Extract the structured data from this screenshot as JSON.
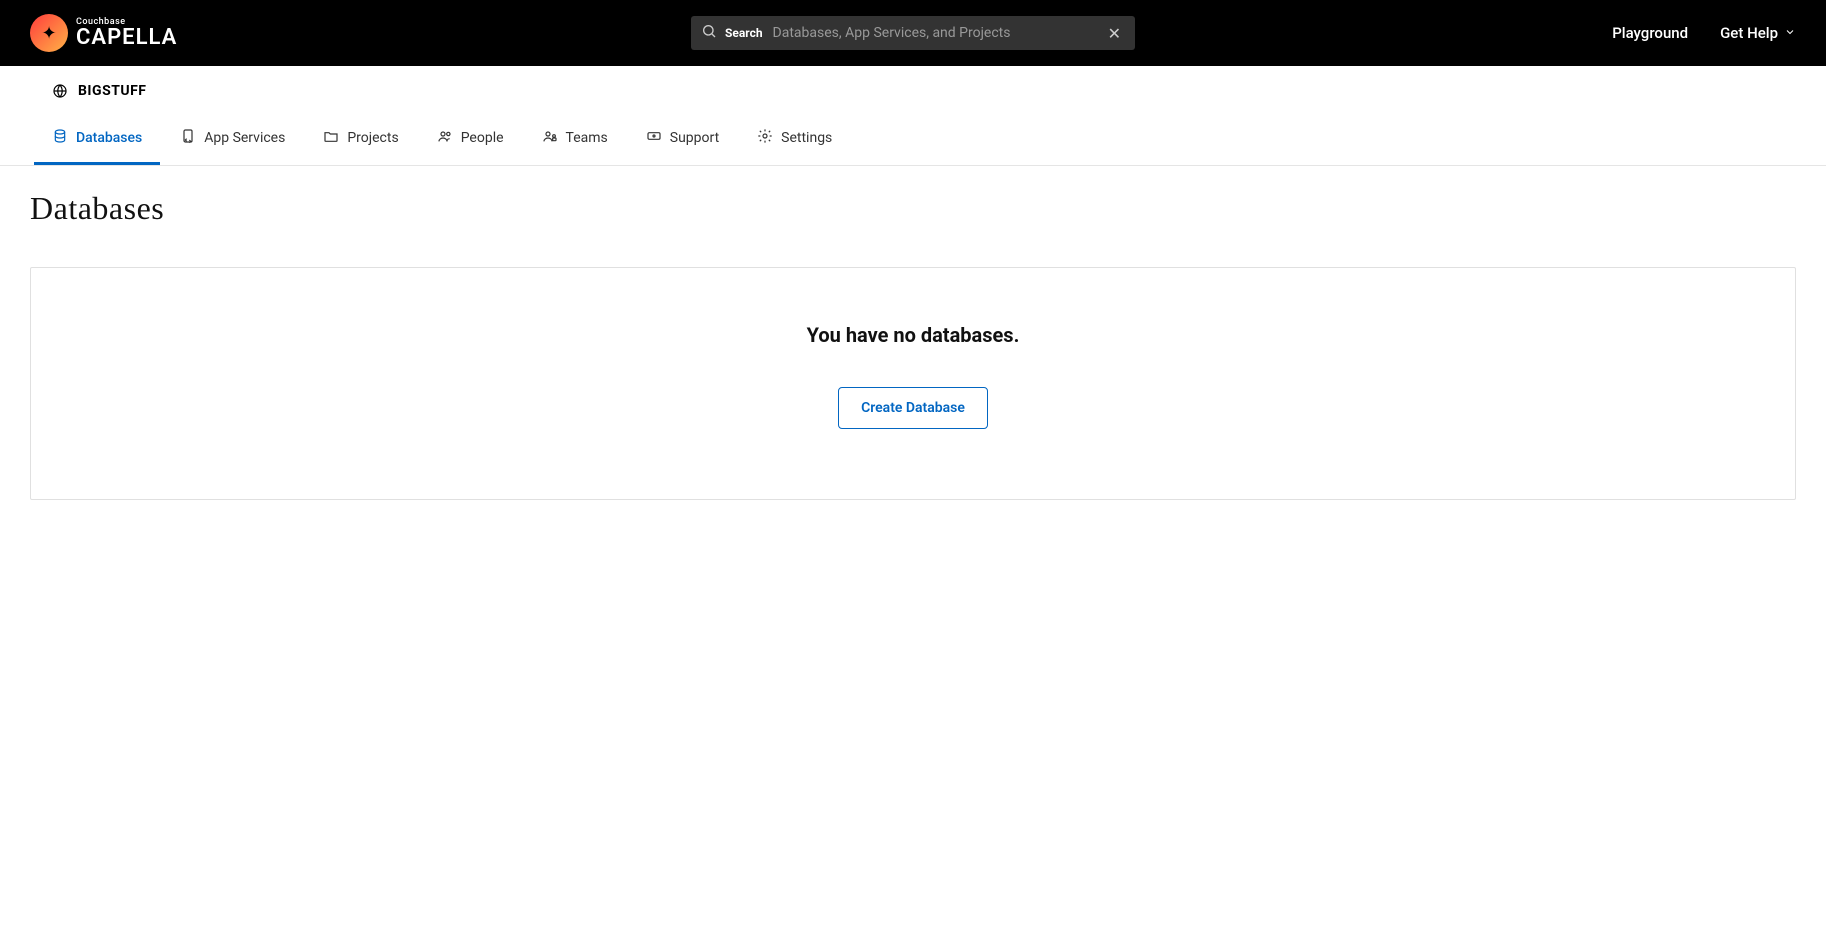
{
  "brand": {
    "line1": "Couchbase",
    "line2": "CAPELLA"
  },
  "search": {
    "label": "Search",
    "placeholder": "Databases, App Services, and Projects"
  },
  "top_nav": {
    "playground": "Playground",
    "get_help": "Get Help"
  },
  "org": {
    "name": "BIGSTUFF"
  },
  "tabs": [
    {
      "id": "databases",
      "label": "Databases",
      "active": true
    },
    {
      "id": "appservices",
      "label": "App Services",
      "active": false
    },
    {
      "id": "projects",
      "label": "Projects",
      "active": false
    },
    {
      "id": "people",
      "label": "People",
      "active": false
    },
    {
      "id": "teams",
      "label": "Teams",
      "active": false
    },
    {
      "id": "support",
      "label": "Support",
      "active": false
    },
    {
      "id": "settings",
      "label": "Settings",
      "active": false
    }
  ],
  "page": {
    "title": "Databases"
  },
  "empty_state": {
    "heading": "You have no databases.",
    "cta_label": "Create Database"
  },
  "colors": {
    "accent": "#0266c2",
    "topbar_bg": "#000000"
  }
}
